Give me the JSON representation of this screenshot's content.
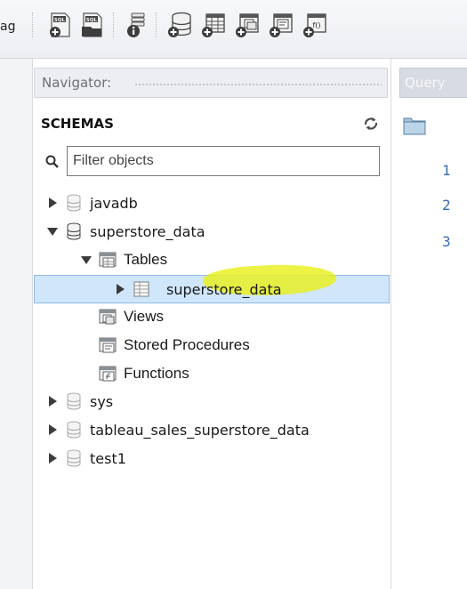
{
  "toolbar": {
    "cut_text": "ag",
    "buttons": [
      {
        "name": "new-sql-tab",
        "badge": "SQL"
      },
      {
        "name": "open-sql-script",
        "badge": "SQL"
      },
      {
        "name": "schema-inspector"
      },
      {
        "name": "create-schema"
      },
      {
        "name": "create-table"
      },
      {
        "name": "create-view"
      },
      {
        "name": "create-procedure"
      },
      {
        "name": "create-function",
        "badge": "f()"
      }
    ]
  },
  "navigator": {
    "title": "Navigator:",
    "schemas_label": "SCHEMAS",
    "filter": {
      "placeholder": "Filter objects",
      "value": ""
    },
    "tree": {
      "javadb": "javadb",
      "superstore_data": "superstore_data",
      "tables": "Tables",
      "superstore_table": "superstore_data",
      "views": "Views",
      "stored_procedures": "Stored Procedures",
      "functions": "Functions",
      "sys": "sys",
      "tableau": "tableau_sales_superstore_data",
      "test1": "test1"
    }
  },
  "query": {
    "tab_label": "Query",
    "line_numbers": [
      "1",
      "2",
      "3"
    ]
  },
  "colors": {
    "selection": "#cfe6fb",
    "highlighter": "#e8f018",
    "line_numbers": "#3b6bb3"
  }
}
